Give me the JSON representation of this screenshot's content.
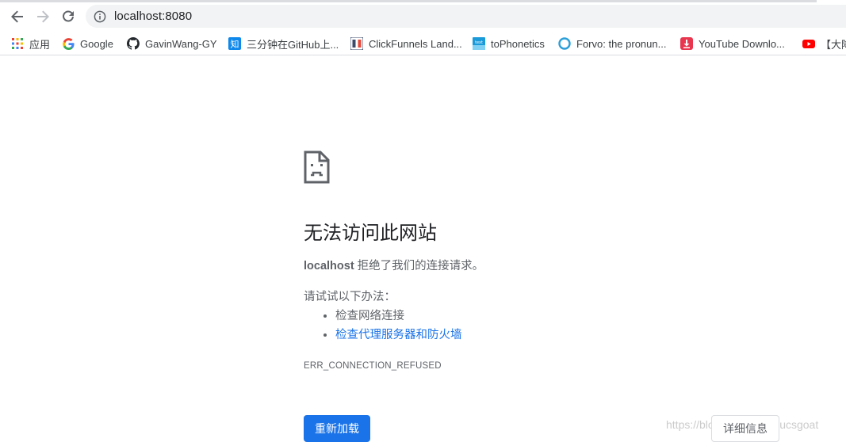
{
  "browser": {
    "url": "localhost:8080"
  },
  "bookmarks": [
    {
      "label": "应用",
      "icon": "apps-grid-icon"
    },
    {
      "label": "Google",
      "icon": "google-icon"
    },
    {
      "label": "GavinWang-GY",
      "icon": "github-icon"
    },
    {
      "label": "三分钟在GitHub上...",
      "icon": "zhihu-icon"
    },
    {
      "label": "ClickFunnels Land...",
      "icon": "clickfunnels-icon"
    },
    {
      "label": "toPhonetics",
      "icon": "tophonetics-icon"
    },
    {
      "label": "Forvo: the pronun...",
      "icon": "forvo-icon"
    },
    {
      "label": "YouTube Downlo...",
      "icon": "download-icon"
    },
    {
      "label": "【大降",
      "icon": "youtube-icon"
    }
  ],
  "error": {
    "title": "无法访问此网站",
    "host": "localhost",
    "desc_rest": " 拒绝了我们的连接请求。",
    "try_label": "请试试以下办法：",
    "suggestions": [
      "检查网络连接",
      "检查代理服务器和防火墙"
    ],
    "code": "ERR_CONNECTION_REFUSED",
    "reload_label": "重新加载",
    "details_label": "详细信息"
  },
  "watermark": "https://blog.csdn.net/csucsgoat",
  "colors": {
    "accent": "#1a73e8",
    "text_secondary": "#5f6368"
  }
}
